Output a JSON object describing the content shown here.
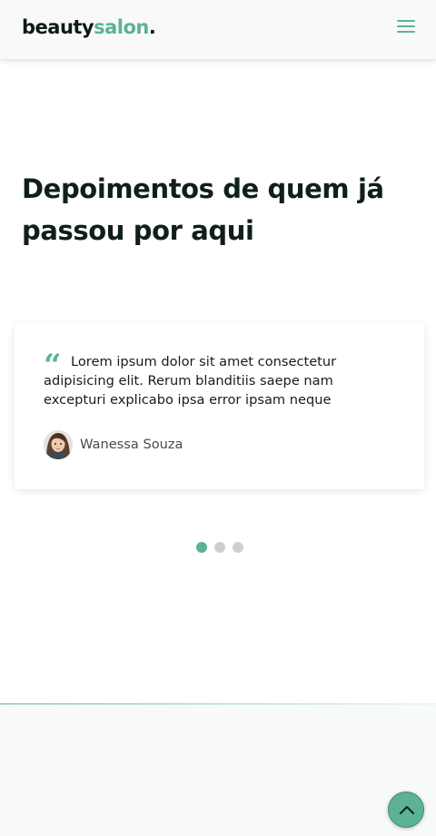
{
  "header": {
    "logo_part1": "beauty",
    "logo_part2": "salon",
    "logo_dot": ".",
    "menu_icon": "hamburger-menu-icon"
  },
  "testimonials": {
    "title_line1": "Depoimentos de quem já",
    "title_line2": "passou por aqui",
    "quote_mark": "“",
    "items": [
      {
        "text": "Lorem ipsum dolor sit amet consectetur adipisicing elit. Rerum blanditiis saepe nam excepturi explicabo ipsa error ipsam neque",
        "author": "Wanessa Souza",
        "avatar": "avatar-photo"
      }
    ],
    "carousel_pages": 3,
    "active_page": 1
  },
  "back_to_top": {
    "icon": "chevron-up-icon"
  },
  "colors": {
    "accent": "#5cb394",
    "text_dark": "#0f1f1a",
    "header_bg": "#f9f9f9",
    "footer_bg": "#f8f9f9",
    "dot_inactive": "#cfcfcf"
  }
}
